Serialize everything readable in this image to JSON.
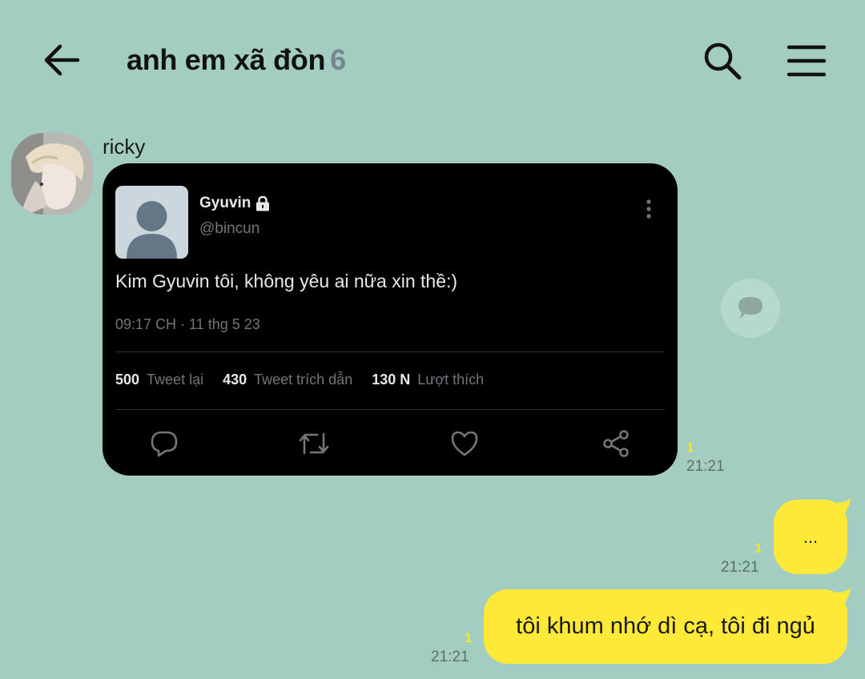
{
  "header": {
    "title": "anh em xã đòn",
    "member_count": "6",
    "back_icon": "arrow-left-icon",
    "search_icon": "search-icon",
    "menu_icon": "hamburger-menu-icon"
  },
  "messages": {
    "incoming": {
      "sender": "ricky",
      "tweet": {
        "display_name": "Gyuvin",
        "handle": "@bincun",
        "text": "Kim Gyuvin tôi, không yêu ai nữa xin thề:)",
        "time": "09:17 CH · 11 thg 5 23",
        "retweets": "500",
        "retweets_label": "Tweet lại",
        "quotes": "430",
        "quotes_label": "Tweet trích dẫn",
        "likes": "130 N",
        "likes_label": "Lượt thích"
      },
      "unread": "1",
      "time": "21:21"
    },
    "outgoing": [
      {
        "text": "...",
        "unread": "1",
        "time": "21:21"
      },
      {
        "text": "tôi khum nhớ dì cạ, tôi đi ngủ",
        "unread": "1",
        "time": "21:21"
      }
    ]
  },
  "colors": {
    "background": "#a4cdc1",
    "outgoing_bubble": "#fee939",
    "unread": "#f5e33b",
    "tweet_card": "#000000"
  }
}
